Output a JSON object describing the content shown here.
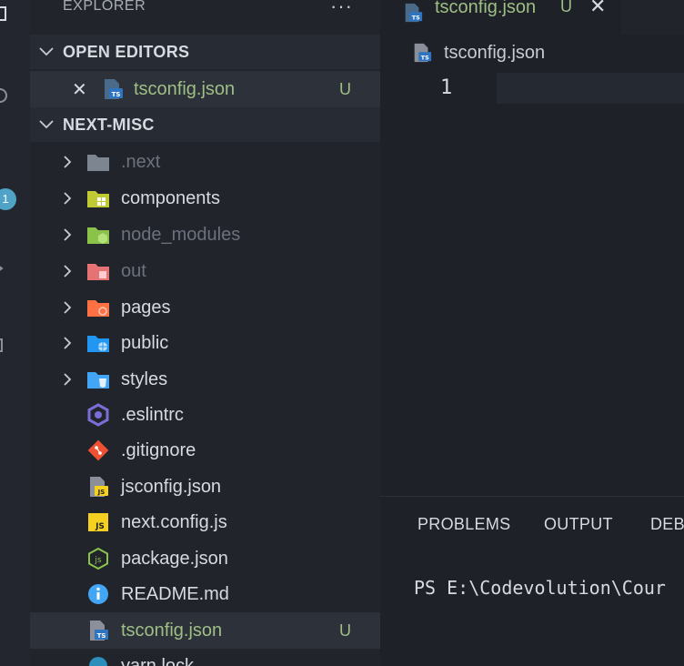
{
  "sidebar": {
    "title": "EXPLORER",
    "more": "···",
    "open_editors": {
      "label": "OPEN EDITORS",
      "items": [
        {
          "close": "✕",
          "name": "tsconfig.json",
          "status": "U"
        }
      ]
    },
    "project": {
      "label": "NEXT-MISC",
      "items": [
        {
          "name": ".next",
          "kind": "folder",
          "icon": "folder-gray-icon"
        },
        {
          "name": "components",
          "kind": "folder",
          "icon": "folder-components-icon"
        },
        {
          "name": "node_modules",
          "kind": "folder",
          "icon": "folder-node-icon"
        },
        {
          "name": "out",
          "kind": "folder",
          "icon": "folder-out-icon"
        },
        {
          "name": "pages",
          "kind": "folder",
          "icon": "folder-pages-icon"
        },
        {
          "name": "public",
          "kind": "folder",
          "icon": "folder-public-icon"
        },
        {
          "name": "styles",
          "kind": "folder",
          "icon": "folder-styles-icon"
        },
        {
          "name": ".eslintrc",
          "kind": "file",
          "icon": "eslint-icon"
        },
        {
          "name": ".gitignore",
          "kind": "file",
          "icon": "git-icon"
        },
        {
          "name": "jsconfig.json",
          "kind": "file",
          "icon": "jsconfig-icon"
        },
        {
          "name": "next.config.js",
          "kind": "file",
          "icon": "js-icon"
        },
        {
          "name": "package.json",
          "kind": "file",
          "icon": "nodejs-icon"
        },
        {
          "name": "README.md",
          "kind": "file",
          "icon": "info-icon"
        },
        {
          "name": "tsconfig.json",
          "kind": "file",
          "icon": "tsconfig-icon",
          "status": "U"
        },
        {
          "name": "yarn.lock",
          "kind": "file",
          "icon": "yarn-icon"
        }
      ]
    },
    "activity_badge": "1"
  },
  "editor": {
    "tab": {
      "name": "tsconfig.json",
      "status": "U",
      "close": "✕"
    },
    "breadcrumb": "tsconfig.json",
    "line_number": "1"
  },
  "panel": {
    "tabs": [
      "PROBLEMS",
      "OUTPUT",
      "DEBU"
    ],
    "terminal_line": "PS E:\\Codevolution\\Cour"
  },
  "colors": {
    "untracked": "#9fbf85",
    "sidebar_bg": "#21252b",
    "editor_bg": "#1e2127"
  }
}
